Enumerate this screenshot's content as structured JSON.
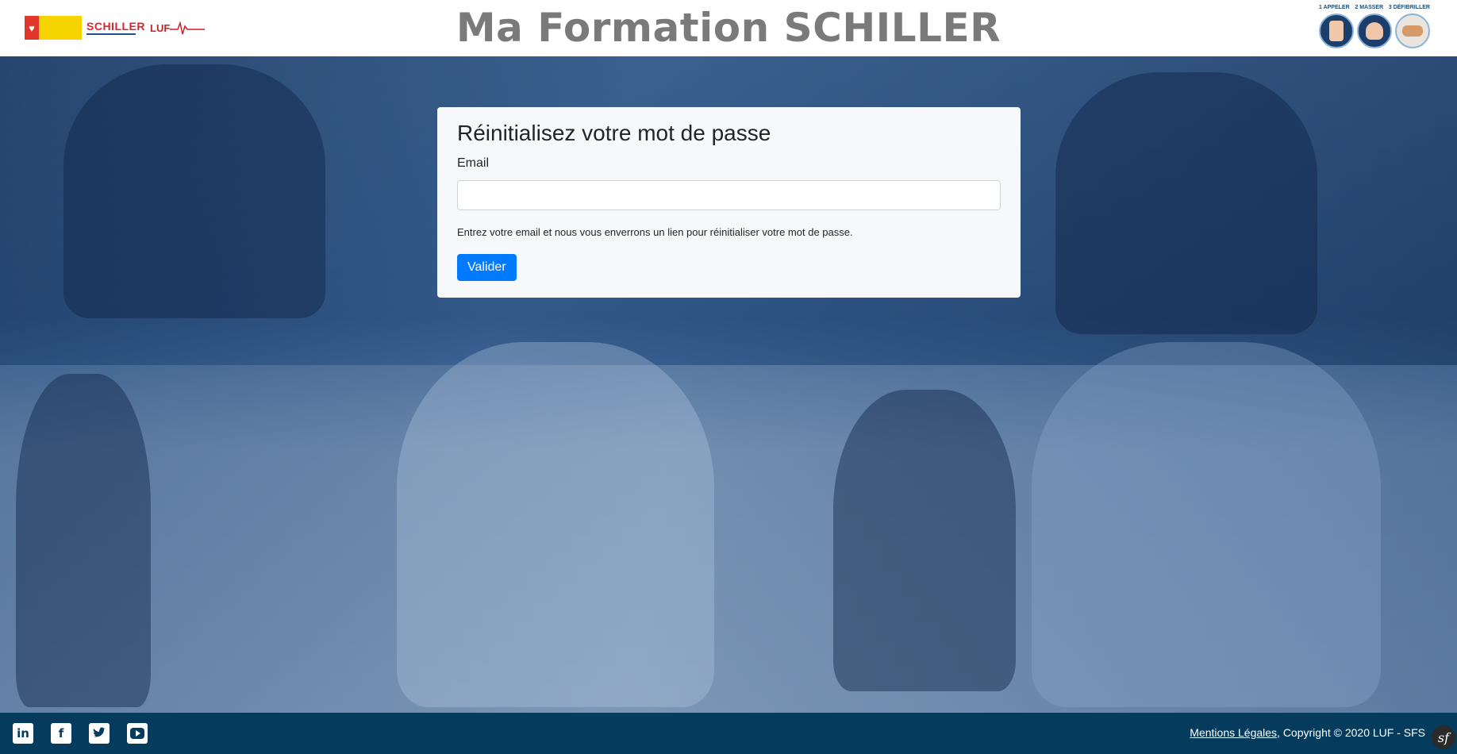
{
  "header": {
    "title": "Ma Formation SCHILLER",
    "logos_left": {
      "schiller_name": "SCHILLER",
      "luf_name": "LUF"
    },
    "steps": [
      "1 APPELER",
      "2 MASSER",
      "3 DÉFIBRILLER"
    ]
  },
  "card": {
    "title": "Réinitialisez votre mot de passe",
    "email_label": "Email",
    "email_value": "",
    "help_text": "Entrez votre email et nous vous enverrons un lien pour réinitialiser votre mot de passe.",
    "submit_label": "Valider"
  },
  "footer": {
    "social": [
      "linkedin-icon",
      "facebook-icon",
      "twitter-icon",
      "youtube-icon"
    ],
    "legal_link": "Mentions Légales",
    "copyright": ", Copyright © 2020 LUF - SFS"
  },
  "colors": {
    "primary_button": "#007bff",
    "footer_bg": "#053b5c",
    "title_gray": "#7a7a7a"
  }
}
